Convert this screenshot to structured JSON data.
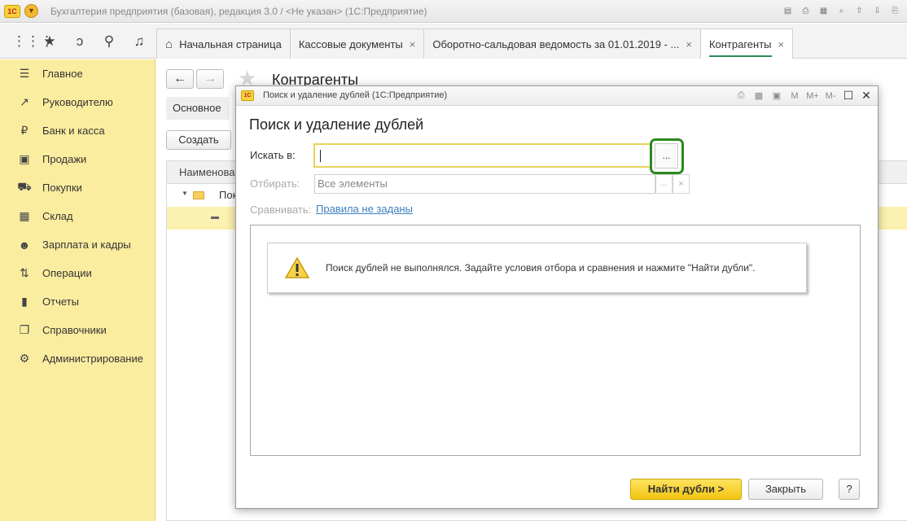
{
  "window": {
    "logo": "1С",
    "title": "Бухгалтерия предприятия (базовая), редакция 3.0 / <Не указан>  (1С:Предприятие)"
  },
  "tabs": [
    {
      "label": "Начальная страница"
    },
    {
      "label": "Кассовые документы",
      "close": "×"
    },
    {
      "label": "Оборотно-сальдовая ведомость за 01.01.2019 - ...",
      "close": "×"
    },
    {
      "label": "Контрагенты",
      "close": "×"
    }
  ],
  "sidebar": {
    "items": [
      {
        "label": "Главное",
        "icon": "menu-icon"
      },
      {
        "label": "Руководителю",
        "icon": "trend-icon"
      },
      {
        "label": "Банк и касса",
        "icon": "ruble-icon"
      },
      {
        "label": "Продажи",
        "icon": "bag-icon"
      },
      {
        "label": "Покупки",
        "icon": "cart-icon"
      },
      {
        "label": "Склад",
        "icon": "warehouse-icon"
      },
      {
        "label": "Зарплата и кадры",
        "icon": "people-icon"
      },
      {
        "label": "Операции",
        "icon": "operations-icon"
      },
      {
        "label": "Отчеты",
        "icon": "report-icon"
      },
      {
        "label": "Справочники",
        "icon": "books-icon"
      },
      {
        "label": "Администрирование",
        "icon": "gear-icon"
      }
    ]
  },
  "background_form": {
    "title": "Контрагенты",
    "tab_main": "Основное",
    "create_button": "Создать",
    "column_header": "Наименова",
    "row_text": "Пок"
  },
  "dialog": {
    "window_title": "Поиск и удаление дублей  (1С:Предприятие)",
    "heading": "Поиск и удаление дублей",
    "search_in_label": "Искать в:",
    "search_in_value": "",
    "choose_button": "...",
    "filter_label": "Отбирать:",
    "filter_value": "Все элементы",
    "filter_choose": "...",
    "filter_clear": "×",
    "compare_label": "Сравнивать:",
    "compare_link": "Правила не заданы",
    "info_message": "Поиск дублей не выполнялся.  Задайте условия отбора и сравнения и нажмите \"Найти дубли\".",
    "find_button": "Найти дубли >",
    "close_button": "Закрыть",
    "help_button": "?",
    "toolbar": {
      "m": "M",
      "m_plus": "M+",
      "m_minus": "M-"
    }
  },
  "colors": {
    "sidebar_bg": "#fbeda0",
    "accent_yellow": "#f2c512",
    "highlight_green": "#2a8a1d",
    "link_blue": "#3d80c0"
  }
}
